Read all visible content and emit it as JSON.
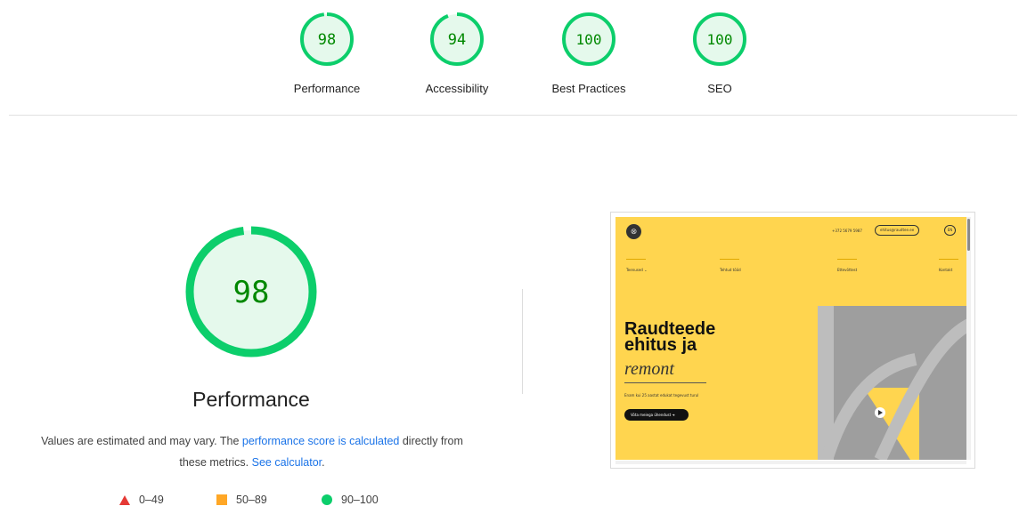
{
  "colors": {
    "pass_green": "#0cce6b",
    "pass_text": "#008800",
    "gauge_fill": "#e5f9ec",
    "link_blue": "#1a73e8",
    "fail_red": "#e53935",
    "average_orange": "#ffa726",
    "screenshot_yellow": "#ffd54f"
  },
  "summary": {
    "categories": [
      {
        "label": "Performance",
        "score": "98",
        "score_value": 98
      },
      {
        "label": "Accessibility",
        "score": "94",
        "score_value": 94
      },
      {
        "label": "Best Practices",
        "score": "100",
        "score_value": 100
      },
      {
        "label": "SEO",
        "score": "100",
        "score_value": 100
      }
    ]
  },
  "performance": {
    "score": "98",
    "score_value": 98,
    "title": "Performance",
    "description_prefix": "Values are estimated and may vary. The ",
    "score_link": "performance score is calculated",
    "description_middle": " directly from these metrics. ",
    "calculator_link": "See calculator",
    "description_suffix": "."
  },
  "legend": {
    "fail": {
      "icon": "red-triangle-icon",
      "label": "0–49"
    },
    "average": {
      "icon": "orange-square-icon",
      "label": "50–89"
    },
    "pass": {
      "icon": "green-circle-icon",
      "label": "90–100"
    }
  },
  "screenshot": {
    "logo_icon": "rail-logo-icon",
    "phone": "+372 5679 5987",
    "email": "ehitus@raudtee.ee",
    "language": "EN",
    "nav": [
      "Teenused ⌄",
      "Tehtud tööd",
      "Ettevõttest",
      "Kontakt"
    ],
    "headline_lines": [
      "Raudteede",
      "ehitus ja"
    ],
    "headline_italic": "remont",
    "subtitle": "Enam kui 25 aastat edukat tegevust turul",
    "cta": "Võta meiega ühendust  ➜"
  }
}
